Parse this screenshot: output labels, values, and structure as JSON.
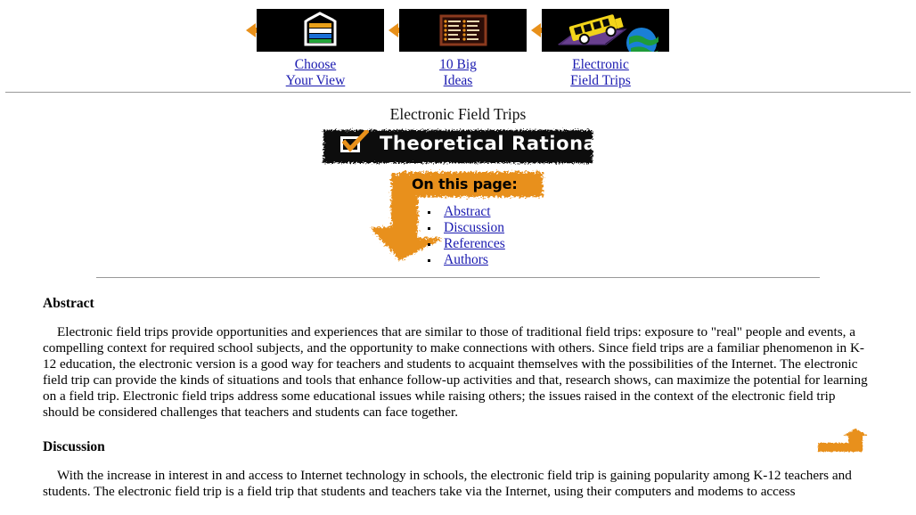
{
  "nav": {
    "items": [
      {
        "label_line1": "Choose",
        "label_line2": "Your View",
        "icon": "layered-view-icon",
        "arrow": "left-arrow-icon"
      },
      {
        "label_line1": "10 Big",
        "label_line2": "Ideas",
        "icon": "list-board-icon",
        "arrow": "left-arrow-icon"
      },
      {
        "label_line1": "Electronic",
        "label_line2": "Field Trips",
        "icon": "school-bus-globe-icon",
        "arrow": "left-arrow-icon"
      }
    ]
  },
  "page": {
    "title": "Electronic Field Trips",
    "banner_title": "Theoretical Rationale",
    "banner_icon": "checkbox-check-icon",
    "on_this_page_label": "On this page:",
    "on_this_page_links": [
      "Abstract",
      "Discussion",
      "References",
      "Authors"
    ],
    "back_to_top_icon": "curved-up-arrow-icon"
  },
  "sections": {
    "abstract": {
      "heading": "Abstract",
      "text": "Electronic field trips provide opportunities and experiences that are similar to those of traditional field trips: exposure to \"real\" people and events, a compelling context for required school subjects, and the opportunity to make connections with others. Since field trips are a familiar phenomenon in K-12 education, the electronic version is a good way for teachers and students to acquaint themselves with the possibilities of the Internet. The electronic field trip can provide the kinds of situations and tools that enhance follow-up activities and that, research shows, can maximize the potential for learning on a field trip. Electronic field trips address some educational issues while raising others; the issues raised in the context of the electronic field trip should be considered challenges that teachers and students can face together."
    },
    "discussion": {
      "heading": "Discussion",
      "text": "With the increase in interest in and access to Internet technology in schools, the electronic field trip is gaining popularity among K-12 teachers and students. The electronic field trip is a field trip that students and teachers take via the Internet, using their computers and modems to access"
    }
  },
  "colors": {
    "link": "#1a1ab0",
    "accent_orange": "#E8901A",
    "banner_bg": "#000000",
    "rule": "#999999",
    "text": "#000000"
  }
}
